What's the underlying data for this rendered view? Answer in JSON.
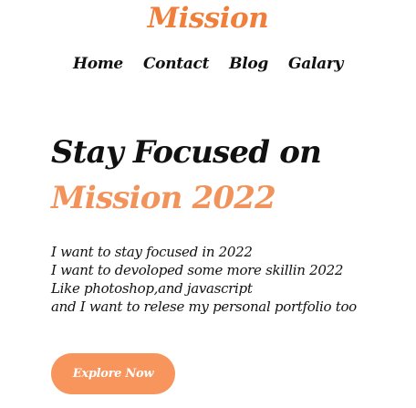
{
  "header": {
    "brand": "Mission",
    "nav": [
      {
        "label": "Home"
      },
      {
        "label": "Contact"
      },
      {
        "label": "Blog"
      },
      {
        "label": "Galary"
      }
    ]
  },
  "hero": {
    "title_line1": "Stay Focused on",
    "title_line2": "Mission 2022",
    "description": [
      "I want to stay focused in 2022",
      "I want to devoloped some more skillin 2022",
      "Like photoshop,and javascript",
      "and I want to relese my personal portfolio too"
    ],
    "cta_label": "Explore Now"
  },
  "colors": {
    "accent": "#f07f3c",
    "accent_light": "#f2935b",
    "button": "#f7955c",
    "text": "#111111"
  }
}
